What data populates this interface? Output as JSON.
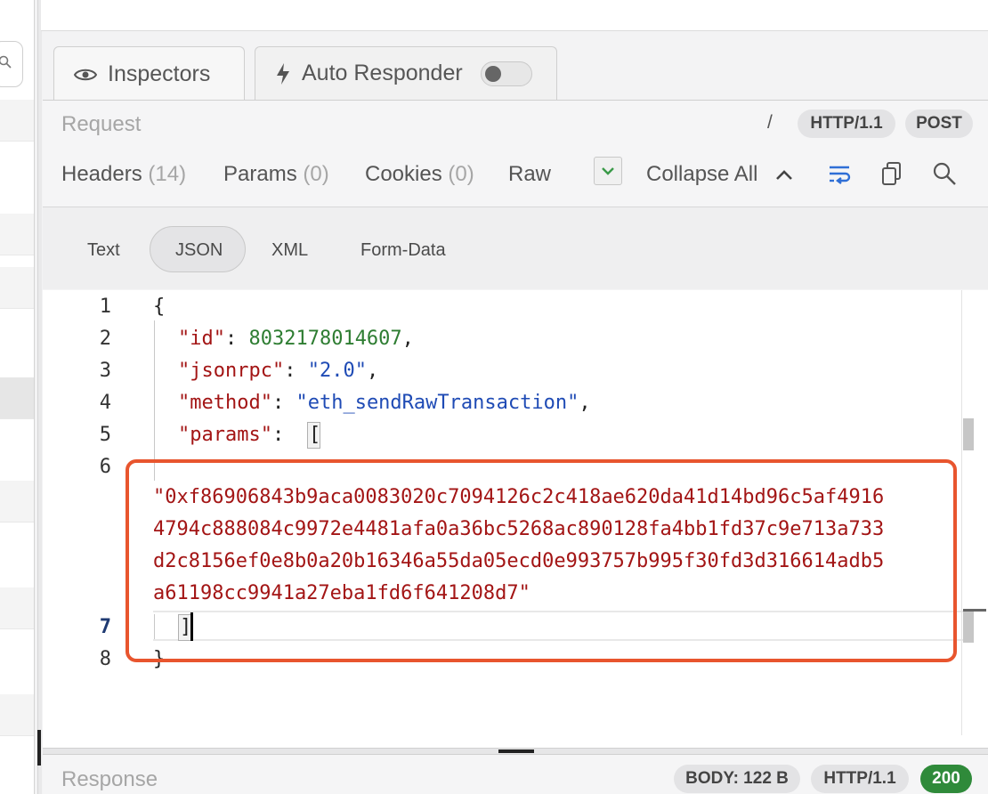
{
  "tabs": {
    "inspectors_label": "Inspectors",
    "inspectors_icon": "eye-icon",
    "auto_responder_label": "Auto Responder",
    "auto_responder_icon": "lightning-icon",
    "auto_responder_enabled": false
  },
  "request": {
    "section_label": "Request",
    "path": "/",
    "protocol": "HTTP/1.1",
    "method": "POST",
    "tabs": [
      {
        "label": "Headers",
        "count": "(14)"
      },
      {
        "label": "Params",
        "count": "(0)"
      },
      {
        "label": "Cookies",
        "count": "(0)"
      },
      {
        "label": "Raw",
        "count": ""
      }
    ],
    "collapse_all_label": "Collapse All",
    "toolbar_icons": [
      "check-icon",
      "chevron-up-icon",
      "wrap-lines-icon",
      "copy-icon",
      "search-icon"
    ],
    "body_formats": [
      "Text",
      "JSON",
      "XML",
      "Form-Data"
    ],
    "selected_format": "JSON"
  },
  "editor": {
    "line_numbers": [
      "1",
      "2",
      "3",
      "4",
      "5",
      "6",
      "7",
      "8"
    ],
    "active_line": "7",
    "open_brace": "{",
    "close_brace": "}",
    "id_key": "\"id\"",
    "id_value": "8032178014607",
    "jsonrpc_key": "\"jsonrpc\"",
    "jsonrpc_value": "\"2.0\"",
    "method_key": "\"method\"",
    "method_value": "\"eth_sendRawTransaction\"",
    "params_key": "\"params\"",
    "params_open": "[",
    "params_close": "]",
    "raw_tx_lines": [
      "\"0xf86906843b9aca0083020c7094126c2c418ae620da41d14bd96c5af4916",
      "4794c888084c9972e4481afa0a36bc5268ac890128fa4bb1fd37c9e713a733",
      "d2c8156ef0e8b0a20b16346a55da05ecd0e993757b995f30fd3d316614adb5",
      "a61198cc9941a27eba1fd6f641208d7\""
    ],
    "highlight_color": "#e8552e"
  },
  "response": {
    "section_label": "Response",
    "body_size": "BODY: 122 B",
    "protocol": "HTTP/1.1",
    "status": "200",
    "status_color": "#2f8a3a"
  }
}
